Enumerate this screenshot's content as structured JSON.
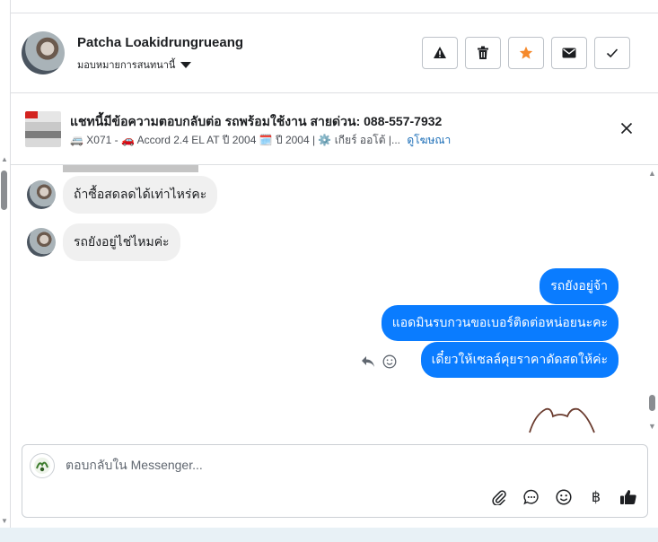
{
  "header": {
    "contact_name": "Patcha Loakidrungrueang",
    "assignment_label": "มอบหมายการสนทนานี้",
    "buttons": {
      "report": "warning-icon",
      "delete": "trash-icon",
      "star": "star-icon",
      "mark_unread": "envelope-icon",
      "done": "check-icon"
    },
    "star_color": "#f5892b"
  },
  "ad": {
    "title": "แชทนี้มีข้อความตอบกลับต่อ รถพร้อมใช้งาน สายด่วน: 088-557-7932",
    "details": "🚐 X071 - 🚗 Accord 2.4 EL AT ปี 2004 🗓️ ปี 2004 | ⚙️ เกียร์ ออโต้ |...",
    "link": "ดูโฆษณา"
  },
  "messages": {
    "incoming": [
      "ถ้าซื้อสดลดได้เท่าไหร่คะ",
      "รถยังอยู่ไช่ไหมค่ะ"
    ],
    "outgoing": [
      "รถยังอยู่จ้า",
      "แอดมินรบกวนขอเบอร์ติดต่อหน่อยนะคะ",
      "เดี๋ยวให้เซลล์คุยราคาดัดสดให้ค่ะ"
    ],
    "outgoing_color": "#0a7cff"
  },
  "composer": {
    "placeholder": "ตอบกลับใน Messenger...",
    "currency_symbol": "฿",
    "tools": [
      "paperclip-icon",
      "chat-bubble-icon",
      "emoji-icon",
      "baht-icon",
      "thumbs-up-icon"
    ]
  }
}
